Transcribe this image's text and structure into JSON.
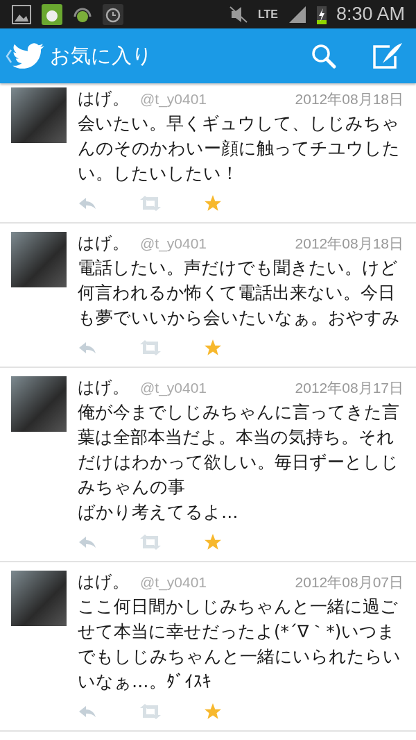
{
  "status_bar": {
    "network": "LTE",
    "time": "8:30 AM"
  },
  "app_bar": {
    "title": "お気に入り"
  },
  "tweets": [
    {
      "name": "はげ。",
      "handle": "@t_y0401",
      "date": "2012年08月18日",
      "paragraphs": [
        "会いたい。早くギュウして、しじみちゃんのそのかわいー顔に触ってチユウしたい。したいしたい！"
      ],
      "favorited": true
    },
    {
      "name": "はげ。",
      "handle": "@t_y0401",
      "date": "2012年08月18日",
      "paragraphs": [
        "電話したい。声だけでも聞きたい。けど何言われるか怖くて電話出来ない。今日も夢でいいから会いたいなぁ。おやすみ"
      ],
      "favorited": true
    },
    {
      "name": "はげ。",
      "handle": "@t_y0401",
      "date": "2012年08月17日",
      "paragraphs": [
        "俺が今までしじみちゃんに言ってきた言葉は全部本当だよ。本当の気持ち。それだけはわかって欲しい。毎日ずーとしじみちゃんの事",
        "ばかり考えてるよ…"
      ],
      "favorited": true
    },
    {
      "name": "はげ。",
      "handle": "@t_y0401",
      "date": "2012年08月07日",
      "paragraphs": [
        "ここ何日間かしじみちゃんと一緒に過ごせて本当に幸せだったよ(*´∇｀*)いつまでもしじみちゃんと一緒にいられたらいいなぁ…。ﾀﾞｲｽｷ"
      ],
      "favorited": true
    }
  ]
}
